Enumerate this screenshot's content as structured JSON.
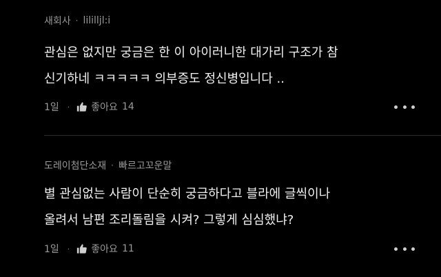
{
  "comments": [
    {
      "company": "새회사",
      "author": "lililljl:i",
      "text": "관심은 없지만 궁금은 한 이 아이러니한 대가리 구조가 참\n신기하네 ㅋㅋㅋㅋㅋ 의부증도 정신병입니다 ..",
      "time": "1일",
      "like_label": "좋아요",
      "like_count": "14"
    },
    {
      "company": "도레이첨단소재",
      "author": "빠르고꼬운말",
      "text": "별 관심없는 사람이 단순히 궁금하다고 블라에 글씩이나\n올려서 남편 조리돌림을 시켜? 그렇게 심심했냐?",
      "time": "1일",
      "like_label": "좋아요",
      "like_count": "11"
    }
  ],
  "icons": {
    "like": "thumbs-up-icon",
    "more": "more-dots-icon"
  },
  "colors": {
    "background": "#000000",
    "text": "#f0f0f0",
    "meta": "#9a9a9a"
  }
}
